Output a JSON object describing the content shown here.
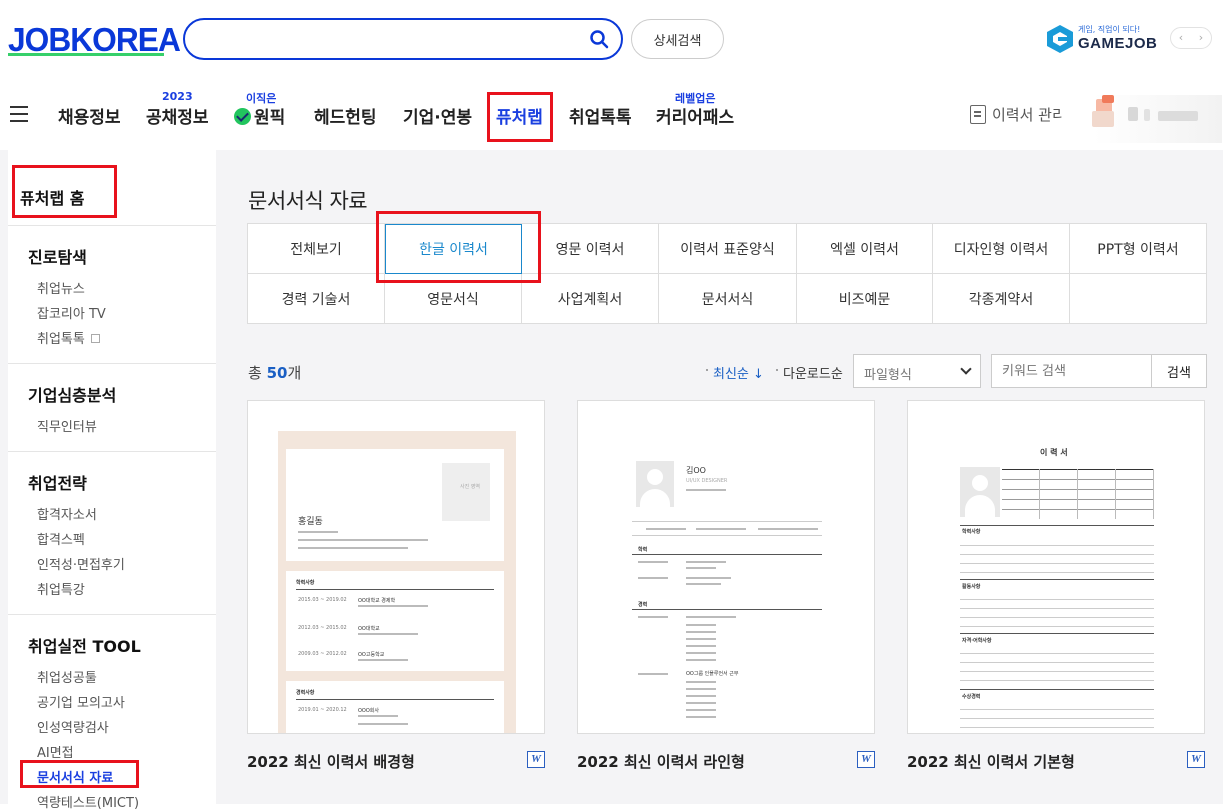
{
  "header": {
    "logo": "JOBKOREA",
    "search": {
      "value": "",
      "placeholder": ""
    },
    "advanced_search_label": "상세검색",
    "gamejob": {
      "tagline": "게임, 직업이 되다!",
      "name": "GAMEJOB"
    },
    "pager": {
      "prev": "‹",
      "next": "›"
    },
    "nav": [
      {
        "label": "채용정보",
        "sup": ""
      },
      {
        "label": "공채정보",
        "sup": "2023"
      },
      {
        "label": "원픽",
        "sup": "이직은"
      },
      {
        "label": "헤드헌팅",
        "sup": ""
      },
      {
        "label": "기업·연봉",
        "sup": ""
      },
      {
        "label": "퓨처랩",
        "sup": ""
      },
      {
        "label": "취업톡톡",
        "sup": ""
      },
      {
        "label": "커리어패스",
        "sup": "레벨업은"
      }
    ],
    "resume_manage": "이력서 관리"
  },
  "sidebar": {
    "home": "퓨처랩 홈",
    "sections": [
      {
        "title": "진로탐색",
        "items": [
          "취업뉴스",
          "잡코리아 TV",
          "취업톡톡"
        ]
      },
      {
        "title": "기업심층분석",
        "items": [
          "직무인터뷰"
        ]
      },
      {
        "title": "취업전략",
        "items": [
          "합격자소서",
          "합격스펙",
          "인적성·면접후기",
          "취업특강"
        ]
      },
      {
        "title": "취업실전 TOOL",
        "items": [
          "취업성공툴",
          "공기업 모의고사",
          "인성역량검사",
          "AI면접",
          "문서서식 자료",
          "역량테스트(MICT)"
        ]
      }
    ]
  },
  "main": {
    "title": "문서서식 자료",
    "categories_row1": [
      "전체보기",
      "한글 이력서",
      "영문 이력서",
      "이력서 표준양식",
      "엑셀 이력서",
      "디자인형 이력서",
      "PPT형 이력서"
    ],
    "categories_row2": [
      "경력 기술서",
      "영문서식",
      "사업계획서",
      "문서서식",
      "비즈예문",
      "각종계약서",
      ""
    ],
    "active_category": "한글 이력서",
    "total_prefix": "총",
    "total_count": "50",
    "total_suffix": "개",
    "sort": [
      "최신순 ↓",
      "다운로드순"
    ],
    "file_type_select": "파일형식",
    "keyword_placeholder": "키워드 검색",
    "search_button": "검색",
    "cards": [
      {
        "title": "2022 최신 이력서 배경형",
        "preview": {
          "name": "홍길동",
          "photo": "사진\n영역",
          "section1": "학력사항",
          "rows1": [
            [
              "2015.03 ~ 2019.02",
              "OO대학교 경제학",
              "졸업예정"
            ],
            [
              "2012.03 ~ 2015.02",
              "OO대학교",
              "졸업"
            ],
            [
              "2009.03 ~ 2012.02",
              "OO고등학교",
              "졸업"
            ]
          ],
          "section2": "경력사항",
          "row2": [
            "2019.01 ~ 2020.12",
            "OOO회사"
          ]
        }
      },
      {
        "title": "2022 최신 이력서 라인형",
        "preview": {
          "name": "김OO",
          "sub": "UI/UX DESIGNER",
          "section1": "학력",
          "section2": "경력",
          "company": "OO그룹 인플루언서 근무"
        }
      },
      {
        "title": "2022 최신 이력서 기본형",
        "preview": {
          "heading": "이 력 서",
          "sections": [
            "학력사항",
            "활동사항",
            "자격·어학사항",
            "수상경력"
          ]
        }
      }
    ],
    "word_icon": "W"
  }
}
